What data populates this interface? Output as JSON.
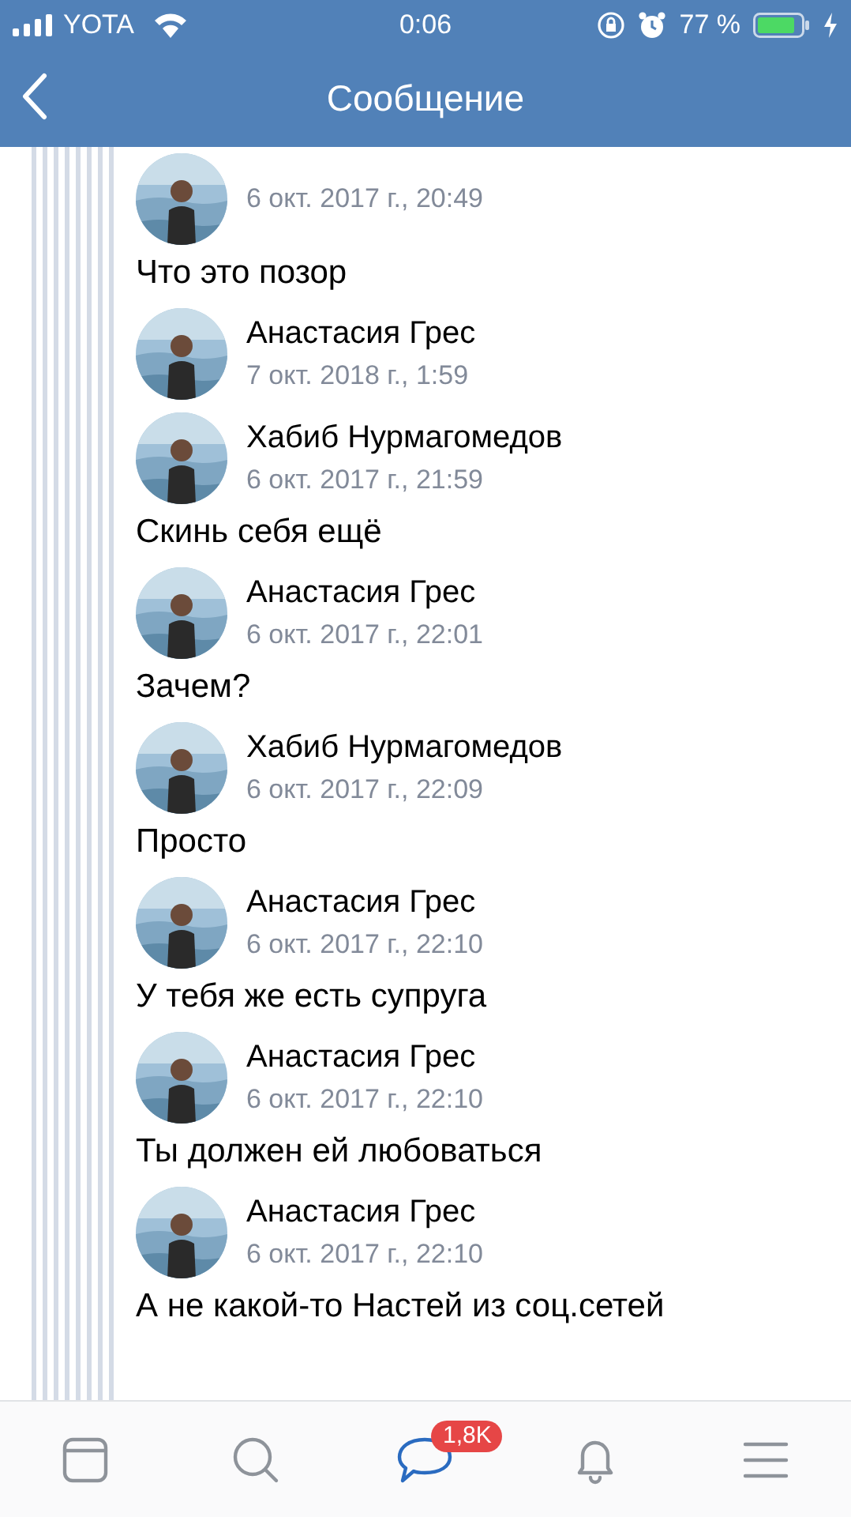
{
  "status_bar": {
    "carrier": "YOTA",
    "time": "0:06",
    "battery": "77 %"
  },
  "header": {
    "title": "Сообщение"
  },
  "messages": [
    {
      "date": "6 окт. 2017 г., 20:49",
      "text": "Что это позор"
    },
    {
      "name": "Анастасия Грес",
      "date": "7 окт. 2018 г., 1:59"
    },
    {
      "name": "Хабиб Нурмагомедов",
      "date": "6 окт. 2017 г., 21:59",
      "text": "Скинь себя ещё"
    },
    {
      "name": "Анастасия Грес",
      "date": "6 окт. 2017 г., 22:01",
      "text": "Зачем?"
    },
    {
      "name": "Хабиб Нурмагомедов",
      "date": "6 окт. 2017 г., 22:09",
      "text": "Просто"
    },
    {
      "name": "Анастасия Грес",
      "date": "6 окт. 2017 г., 22:10",
      "text": "У тебя же есть супруга"
    },
    {
      "name": "Анастасия Грес",
      "date": "6 окт. 2017 г., 22:10",
      "text": "Ты должен ей любоваться"
    },
    {
      "name": "Анастасия Грес",
      "date": "6 окт. 2017 г., 22:10",
      "text": "А не какой-то Настей из соц.сетей"
    }
  ],
  "tab_bar": [
    {
      "selected": false
    },
    {
      "selected": false
    },
    {
      "selected": true,
      "badge": "1,8K"
    },
    {
      "selected": false
    },
    {
      "selected": false
    }
  ]
}
